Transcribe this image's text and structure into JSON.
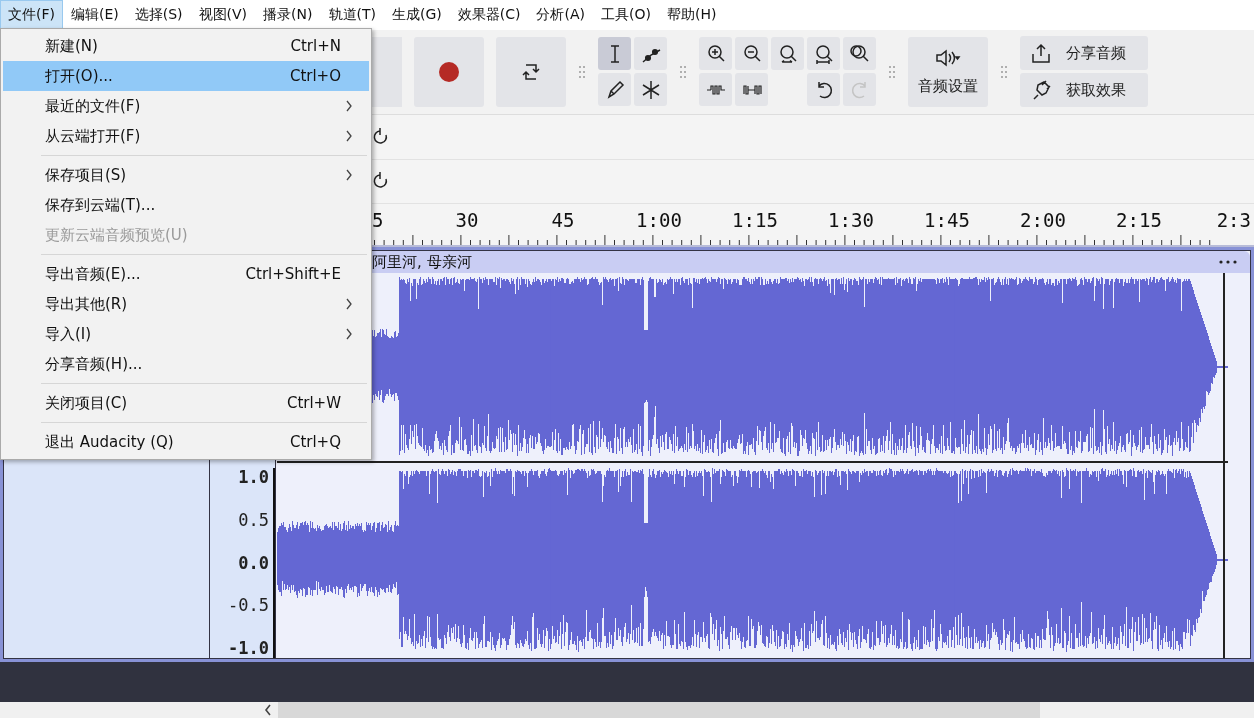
{
  "menubar": [
    {
      "label": "文件(F)",
      "selected": true
    },
    {
      "label": "编辑(E)",
      "selected": false
    },
    {
      "label": "选择(S)",
      "selected": false
    },
    {
      "label": "视图(V)",
      "selected": false
    },
    {
      "label": "播录(N)",
      "selected": false
    },
    {
      "label": "轨道(T)",
      "selected": false
    },
    {
      "label": "生成(G)",
      "selected": false
    },
    {
      "label": "效果器(C)",
      "selected": false
    },
    {
      "label": "分析(A)",
      "selected": false
    },
    {
      "label": "工具(O)",
      "selected": false
    },
    {
      "label": "帮助(H)",
      "selected": false
    }
  ],
  "file_menu": [
    [
      {
        "label": "新建(N)",
        "shortcut": "Ctrl+N",
        "submenu": false,
        "disabled": false,
        "selected": false
      },
      {
        "label": "打开(O)...",
        "shortcut": "Ctrl+O",
        "submenu": false,
        "disabled": false,
        "selected": true
      },
      {
        "label": "最近的文件(F)",
        "submenu": true,
        "disabled": false,
        "selected": false
      },
      {
        "label": "从云端打开(F)",
        "submenu": true,
        "disabled": false,
        "selected": false
      }
    ],
    [
      {
        "label": "保存项目(S)",
        "submenu": true,
        "disabled": false,
        "selected": false
      },
      {
        "label": "保存到云端(T)...",
        "submenu": false,
        "disabled": false,
        "selected": false
      },
      {
        "label": "更新云端音频预览(U)",
        "submenu": false,
        "disabled": true,
        "selected": false
      }
    ],
    [
      {
        "label": "导出音频(E)...",
        "shortcut": "Ctrl+Shift+E",
        "submenu": false,
        "disabled": false,
        "selected": false
      },
      {
        "label": "导出其他(R)",
        "submenu": true,
        "disabled": false,
        "selected": false
      },
      {
        "label": "导入(I)",
        "submenu": true,
        "disabled": false,
        "selected": false
      },
      {
        "label": "分享音频(H)...",
        "submenu": false,
        "disabled": false,
        "selected": false
      }
    ],
    [
      {
        "label": "关闭项目(C)",
        "shortcut": "Ctrl+W",
        "submenu": false,
        "disabled": false,
        "selected": false
      }
    ],
    [
      {
        "label": "退出 Audacity (Q)",
        "shortcut": "Ctrl+Q",
        "submenu": false,
        "disabled": false,
        "selected": false
      }
    ]
  ],
  "tools": [
    {
      "kind": "select",
      "selected": true
    },
    {
      "kind": "envelope",
      "selected": false
    },
    {
      "kind": "draw",
      "selected": false
    },
    {
      "kind": "multi",
      "selected": false
    }
  ],
  "edit_buttons": [
    {
      "kind": "undo",
      "disabled": false
    },
    {
      "kind": "redo",
      "disabled": true
    }
  ],
  "audio_setup": {
    "label": "音频设置"
  },
  "share_audio": {
    "label": "分享音频"
  },
  "get_effects": {
    "label": "获取效果"
  },
  "ruler": [
    "5",
    "30",
    "45",
    "1:00",
    "1:15",
    "1:30",
    "1:45",
    "2:00",
    "2:15",
    "2:3"
  ],
  "track": {
    "clip_title": "阿里河, 母亲河",
    "scale": [
      {
        "label": "1.0",
        "major": true
      },
      {
        "label": "0.5",
        "major": false
      },
      {
        "label": "0.0",
        "major": true
      },
      {
        "label": "-0.5",
        "major": false
      },
      {
        "label": "-1.0",
        "major": true
      }
    ]
  }
}
